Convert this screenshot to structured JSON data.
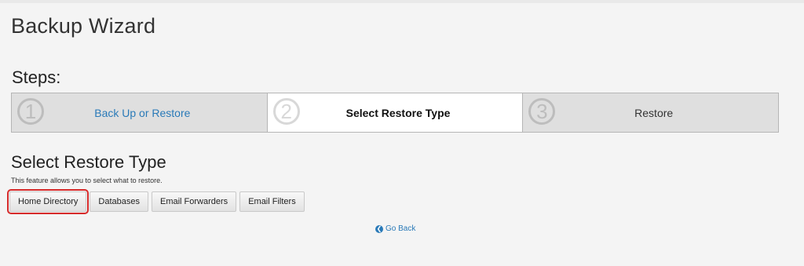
{
  "page": {
    "title": "Backup Wizard"
  },
  "steps": {
    "heading": "Steps:",
    "items": [
      {
        "number": "1",
        "label": "Back Up or Restore"
      },
      {
        "number": "2",
        "label": "Select Restore Type"
      },
      {
        "number": "3",
        "label": "Restore"
      }
    ]
  },
  "restore": {
    "title": "Select Restore Type",
    "description": "This feature allows you to select what to restore.",
    "buttons": [
      {
        "label": "Home Directory"
      },
      {
        "label": "Databases"
      },
      {
        "label": "Email Forwarders"
      },
      {
        "label": "Email Filters"
      }
    ]
  },
  "navigation": {
    "go_back_label": "Go Back",
    "go_back_icon": "arrow-left-circle-icon"
  },
  "colors": {
    "link": "#2a7ab8",
    "highlight": "#d62b2b",
    "step_inactive_bg": "#dfdfdf",
    "step_active_bg": "#ffffff"
  }
}
